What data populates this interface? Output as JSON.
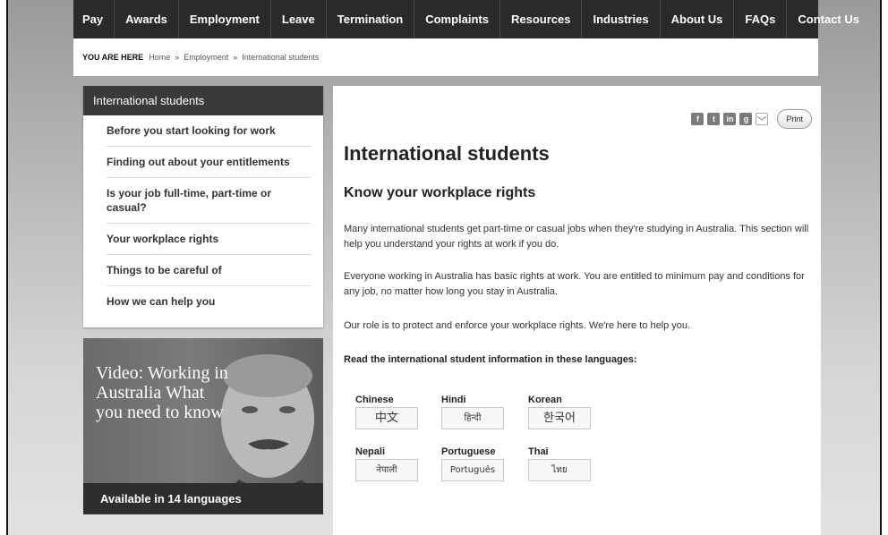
{
  "nav": {
    "items": [
      "Pay",
      "Awards",
      "Employment",
      "Leave",
      "Termination",
      "Complaints",
      "Resources",
      "Industries",
      "About Us",
      "FAQs",
      "Contact Us"
    ]
  },
  "breadcrumb": {
    "label": "YOU ARE HERE",
    "items": [
      "Home",
      "Employment",
      "International students"
    ],
    "separator": "»"
  },
  "sidebar": {
    "title": "International students",
    "items": [
      "Before you start looking for work",
      "Finding out about your entitlements",
      "Is your job full-time, part-time or casual?",
      "Your workplace rights",
      "Things to be careful of",
      "How we can help you"
    ]
  },
  "promo": {
    "title": "Video: Working in Australia What you need to know",
    "strip": "Available in 14 languages"
  },
  "share": {
    "icons": [
      "facebook-icon",
      "twitter-icon",
      "linkedin-icon",
      "googleplus-icon",
      "email-icon"
    ],
    "print_label": "Print"
  },
  "main": {
    "title": "International students",
    "subtitle": "Know your workplace rights",
    "paragraphs": [
      "Many international students get part-time or casual jobs when they're studying in Australia. This section will help you understand your rights at work if you do.",
      "Everyone working in Australia has basic rights at work. You are entitled to minimum pay and conditions for any job, no matter how long you stay in Australia.",
      "Our role is to protect and enforce your workplace rights. We're here to help you."
    ],
    "languages_heading": "Read the international student information in these languages:",
    "languages": [
      {
        "name": "Chinese",
        "native": "中文"
      },
      {
        "name": "Hindi",
        "native": "हिन्दी"
      },
      {
        "name": "Korean",
        "native": "한국어"
      },
      {
        "name": "Nepali",
        "native": "नेपाली"
      },
      {
        "name": "Portuguese",
        "native": "Português"
      },
      {
        "name": "Thai",
        "native": "ไทย"
      }
    ]
  },
  "colors": {
    "nav_bg": "#2a2a2a",
    "sidebar_head_bg": "#3a3a3a",
    "promo_strip_bg": "#2e2e2e"
  }
}
